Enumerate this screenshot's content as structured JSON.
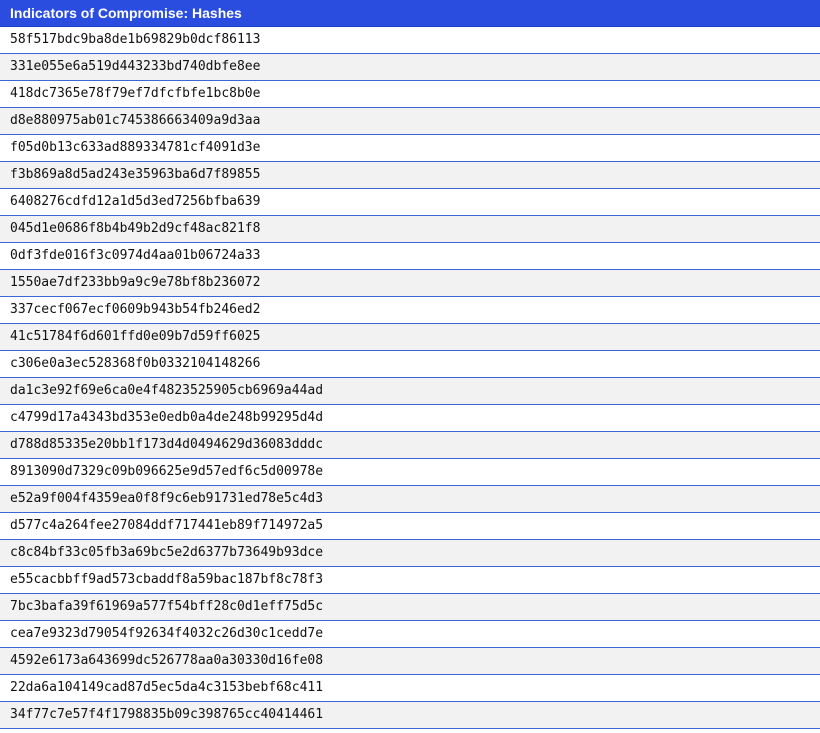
{
  "header": {
    "title": "Indicators of Compromise: Hashes"
  },
  "hashes": [
    "58f517bdc9ba8de1b69829b0dcf86113",
    "331e055e6a519d443233bd740dbfe8ee",
    "418dc7365e78f79ef7dfcfbfe1bc8b0e",
    "d8e880975ab01c745386663409a9d3aa",
    "f05d0b13c633ad889334781cf4091d3e",
    "f3b869a8d5ad243e35963ba6d7f89855",
    "6408276cdfd12a1d5d3ed7256bfba639",
    "045d1e0686f8b4b49b2d9cf48ac821f8",
    "0df3fde016f3c0974d4aa01b06724a33",
    "1550ae7df233bb9a9c9e78bf8b236072",
    "337cecf067ecf0609b943b54fb246ed2",
    "41c51784f6d601ffd0e09b7d59ff6025",
    "c306e0a3ec528368f0b0332104148266",
    "da1c3e92f69e6ca0e4f4823525905cb6969a44ad",
    "c4799d17a4343bd353e0edb0a4de248b99295d4d",
    "d788d85335e20bb1f173d4d0494629d36083dddc",
    "8913090d7329c09b096625e9d57edf6c5d00978e",
    "e52a9f004f4359ea0f8f9c6eb91731ed78e5c4d3",
    "d577c4a264fee27084ddf717441eb89f714972a5",
    "c8c84bf33c05fb3a69bc5e2d6377b73649b93dce",
    "e55cacbbff9ad573cbaddf8a59bac187bf8c78f3",
    "7bc3bafa39f61969a577f54bff28c0d1eff75d5c",
    "cea7e9323d79054f92634f4032c26d30c1cedd7e",
    "4592e6173a643699dc526778aa0a30330d16fe08",
    "22da6a104149cad87d5ec5da4c3153bebf68c411",
    "34f77c7e57f4f1798835b09c398765cc40414461"
  ]
}
